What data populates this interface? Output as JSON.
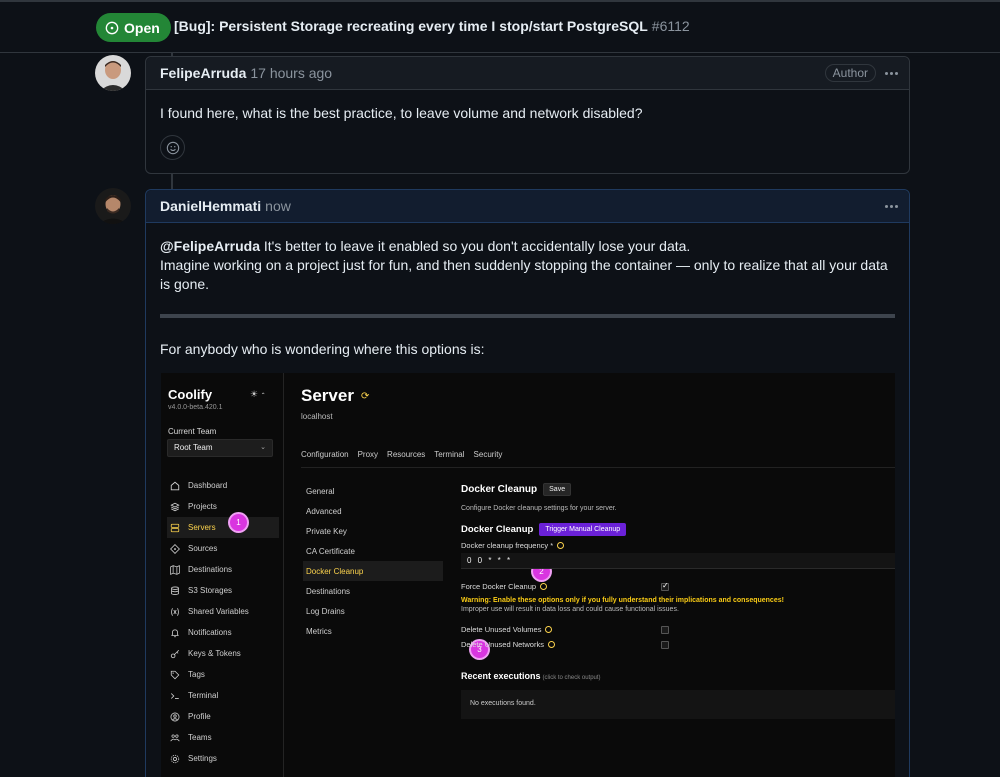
{
  "header": {
    "state": "Open",
    "title": "[Bug]: Persistent Storage recreating every time I stop/start PostgreSQL",
    "number": "#6112"
  },
  "comments": [
    {
      "author": "FelipeArruda",
      "time": "17 hours ago",
      "label": "Author",
      "body": "I found here, what is the best practice, to leave volume and network disabled?"
    },
    {
      "author": "DanielHemmati",
      "time": "now",
      "mention": "@FelipeArruda",
      "body_line1": " It's better to leave it enabled so you don't accidentally lose your data.",
      "body_line2": "Imagine working on a project just for fun, and then suddenly stopping the container — only to realize that all your data is gone.",
      "body_line3": "For anybody who is wondering where this options is:"
    }
  ],
  "screenshot": {
    "app_name": "Coolify",
    "version": "v4.0.0-beta.420.1",
    "team_label": "Current Team",
    "team_value": "Root Team",
    "nav": [
      {
        "label": "Dashboard",
        "icon": "home-icon"
      },
      {
        "label": "Projects",
        "icon": "layers-icon"
      },
      {
        "label": "Servers",
        "icon": "server-icon",
        "active": true
      },
      {
        "label": "Sources",
        "icon": "git-icon"
      },
      {
        "label": "Destinations",
        "icon": "map-icon"
      },
      {
        "label": "S3 Storages",
        "icon": "database-icon"
      },
      {
        "label": "Shared Variables",
        "icon": "variable-icon"
      },
      {
        "label": "Notifications",
        "icon": "bell-icon"
      },
      {
        "label": "Keys & Tokens",
        "icon": "key-icon"
      },
      {
        "label": "Tags",
        "icon": "tag-icon"
      },
      {
        "label": "Terminal",
        "icon": "terminal-icon"
      },
      {
        "label": "Profile",
        "icon": "user-icon"
      },
      {
        "label": "Teams",
        "icon": "users-icon"
      },
      {
        "label": "Settings",
        "icon": "gear-icon"
      }
    ],
    "page_title": "Server",
    "host": "localhost",
    "tabs": [
      "Configuration",
      "Proxy",
      "Resources",
      "Terminal",
      "Security"
    ],
    "sub_nav": [
      "General",
      "Advanced",
      "Private Key",
      "CA Certificate",
      "Docker Cleanup",
      "Destinations",
      "Log Drains",
      "Metrics"
    ],
    "sub_active": "Docker Cleanup",
    "panel": {
      "title": "Docker Cleanup",
      "save": "Save",
      "desc": "Configure Docker cleanup settings for your server.",
      "title2": "Docker Cleanup",
      "trigger": "Trigger Manual Cleanup",
      "freq_label": "Docker cleanup frequency *",
      "freq_value": "0 0 * * *",
      "force_label": "Force Docker Cleanup",
      "warning": "Warning: Enable these options only if you fully understand their implications and consequences!",
      "warning2": "Improper use will result in data loss and could cause functional issues.",
      "volumes_label": "Delete Unused Volumes",
      "networks_label": "Delete Unused Networks",
      "recent_title": "Recent executions",
      "recent_hint": "(click to check output)",
      "empty": "No executions found."
    },
    "steps": [
      "1",
      "2",
      "3"
    ]
  },
  "colors": {
    "open_green": "#238636",
    "accent_yellow": "#fcd34d",
    "step_magenta": "#d935e0",
    "trigger_purple": "#6b21d8"
  }
}
